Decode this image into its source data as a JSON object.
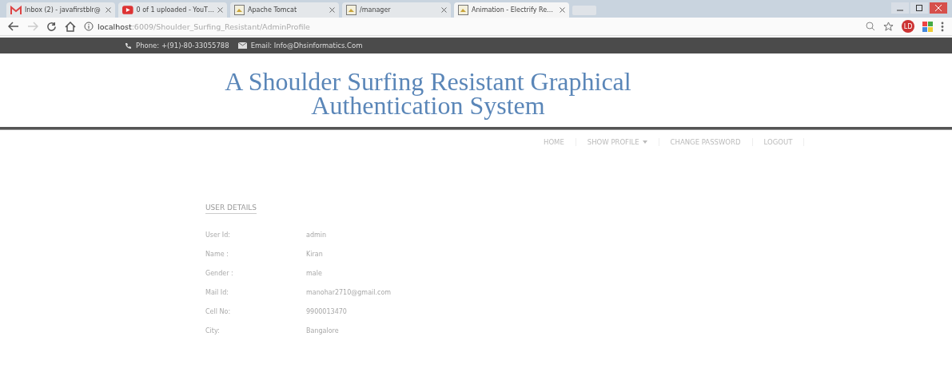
{
  "browser": {
    "tabs": [
      {
        "title": "Inbox (2) - javafirstblr@",
        "kind": "mail",
        "selected": false
      },
      {
        "title": "0 of 1 uploaded - YouT…",
        "kind": "video",
        "selected": false
      },
      {
        "title": "Apache Tomcat",
        "kind": "page",
        "selected": false
      },
      {
        "title": "/manager",
        "kind": "page",
        "selected": false
      },
      {
        "title": "Animation - Electrify Re…",
        "kind": "page",
        "selected": true
      }
    ],
    "address": {
      "host": "localhost",
      "path": ":6009/Shoulder_Surfing_Resistant/AdminProfile"
    },
    "profile_badge": "LD"
  },
  "topbar": {
    "phone": "Phone: +(91)-80-33055788",
    "email": "Email: Info@Dhsinformatics.Com"
  },
  "site_title": [
    "A Shoulder Surfing Resistant Graphical",
    "Authentication System"
  ],
  "nav": [
    {
      "label": "HOME",
      "dropdown": false
    },
    {
      "label": "SHOW PROFILE",
      "dropdown": true
    },
    {
      "label": "CHANGE PASSWORD",
      "dropdown": false
    },
    {
      "label": "LOGOUT",
      "dropdown": false
    }
  ],
  "section_title": "USER DETAILS",
  "details": [
    {
      "label": "User Id:",
      "value": "admin"
    },
    {
      "label": "Name :",
      "value": "Kiran"
    },
    {
      "label": "Gender :",
      "value": "male"
    },
    {
      "label": "Mail Id:",
      "value": "manohar2710@gmail.com"
    },
    {
      "label": "Cell No:",
      "value": "9900013470"
    },
    {
      "label": "City:",
      "value": "Bangalore"
    }
  ]
}
